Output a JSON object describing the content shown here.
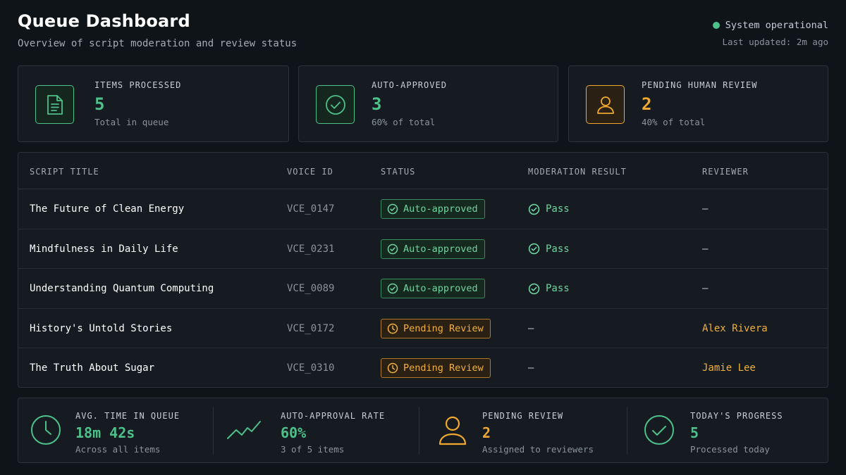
{
  "header": {
    "title": "Queue Dashboard",
    "subtitle": "Overview of script moderation and review status",
    "system_status": "System operational",
    "last_updated": "Last updated: 2m ago"
  },
  "cards": [
    {
      "label": "ITEMS PROCESSED",
      "value": "5",
      "sub": "Total in queue",
      "icon": "document-icon",
      "color": "#4ec08a"
    },
    {
      "label": "AUTO-APPROVED",
      "value": "3",
      "sub": "60% of total",
      "icon": "check-circle-icon",
      "color": "#4ec08a"
    },
    {
      "label": "PENDING HUMAN REVIEW",
      "value": "2",
      "sub": "40% of total",
      "icon": "user-icon",
      "color": "#f0a830"
    }
  ],
  "table": {
    "headers": [
      "SCRIPT TITLE",
      "VOICE ID",
      "STATUS",
      "MODERATION RESULT",
      "REVIEWER"
    ],
    "rows": [
      {
        "title": "The Future of Clean Energy",
        "voice": "VCE_0147",
        "status": "Auto-approved",
        "moderation": "Pass",
        "reviewer": "—"
      },
      {
        "title": "Mindfulness in Daily Life",
        "voice": "VCE_0231",
        "status": "Auto-approved",
        "moderation": "Pass",
        "reviewer": "—"
      },
      {
        "title": "Understanding Quantum Computing",
        "voice": "VCE_0089",
        "status": "Auto-approved",
        "moderation": "Pass",
        "reviewer": "—"
      },
      {
        "title": "History's Untold Stories",
        "voice": "VCE_0172",
        "status": "Pending Review",
        "moderation": "—",
        "reviewer": "Alex Rivera"
      },
      {
        "title": "The Truth About Sugar",
        "voice": "VCE_0310",
        "status": "Pending Review",
        "moderation": "—",
        "reviewer": "Jamie Lee"
      }
    ]
  },
  "stats": [
    {
      "label": "AVG. TIME IN QUEUE",
      "value": "18m 42s",
      "sub": "Across all items",
      "icon": "clock-icon"
    },
    {
      "label": "AUTO-APPROVAL RATE",
      "value": "60%",
      "sub": "3 of 5 items",
      "icon": "trend-line-icon"
    },
    {
      "label": "PENDING REVIEW",
      "value": "2",
      "sub": "Assigned to reviewers",
      "icon": "user-icon"
    },
    {
      "label": "TODAY'S PROGRESS",
      "value": "5",
      "sub": "Processed today",
      "icon": "check-circle-icon"
    }
  ],
  "colors": {
    "green": "#4ec08a",
    "amber": "#f0a830",
    "background": "#0f1419"
  }
}
